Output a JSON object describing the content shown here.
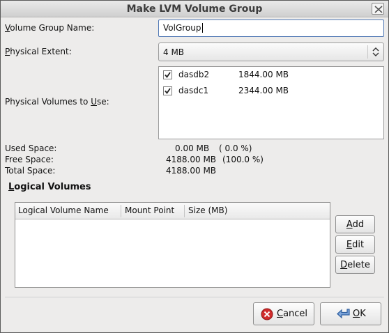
{
  "window": {
    "title": "Make LVM Volume Group"
  },
  "form": {
    "vg_name_label_pre": "V",
    "vg_name_label_rest": "olume Group Name:",
    "vg_name_value": "VolGroup",
    "pe_label_pre": "P",
    "pe_label_rest": "hysical Extent:",
    "pe_value": "4 MB",
    "pv_label_pre": "Physical Volumes to ",
    "pv_label_u": "U",
    "pv_label_post": "se:"
  },
  "physical_volumes": [
    {
      "name": "dasdb2",
      "size": "1844.00 MB",
      "checked": true
    },
    {
      "name": "dasdc1",
      "size": "2344.00 MB",
      "checked": true
    }
  ],
  "space": {
    "used_label": "Used Space:",
    "used_value": "0.00 MB",
    "used_pct": "( 0.0 %)",
    "free_label": "Free Space:",
    "free_value": "4188.00 MB",
    "free_pct": "(100.0 %)",
    "total_label": "Total Space:",
    "total_value": "4188.00 MB"
  },
  "logical_volumes": {
    "heading_u": "L",
    "heading_rest": "ogical Volumes",
    "columns": [
      "Logical Volume Name",
      "Mount Point",
      "Size (MB)"
    ],
    "rows": []
  },
  "side_buttons": {
    "add_u": "A",
    "add_rest": "dd",
    "edit_u": "E",
    "edit_rest": "dit",
    "delete_u": "D",
    "delete_rest": "elete"
  },
  "dialog_buttons": {
    "cancel_u": "C",
    "cancel_rest": "ancel",
    "ok_u": "O",
    "ok_rest": "K"
  },
  "icons": {
    "close": "close-icon",
    "combo_arrow": "up-down-arrow-icon",
    "checkbox": "checkmark-icon",
    "cancel": "cancel-icon",
    "ok": "ok-arrow-icon"
  },
  "colors": {
    "dialog_bg": "#edeceb",
    "focus_border": "#5078b4",
    "cancel_red": "#d02c2c",
    "ok_blue": "#4a7fc8"
  }
}
